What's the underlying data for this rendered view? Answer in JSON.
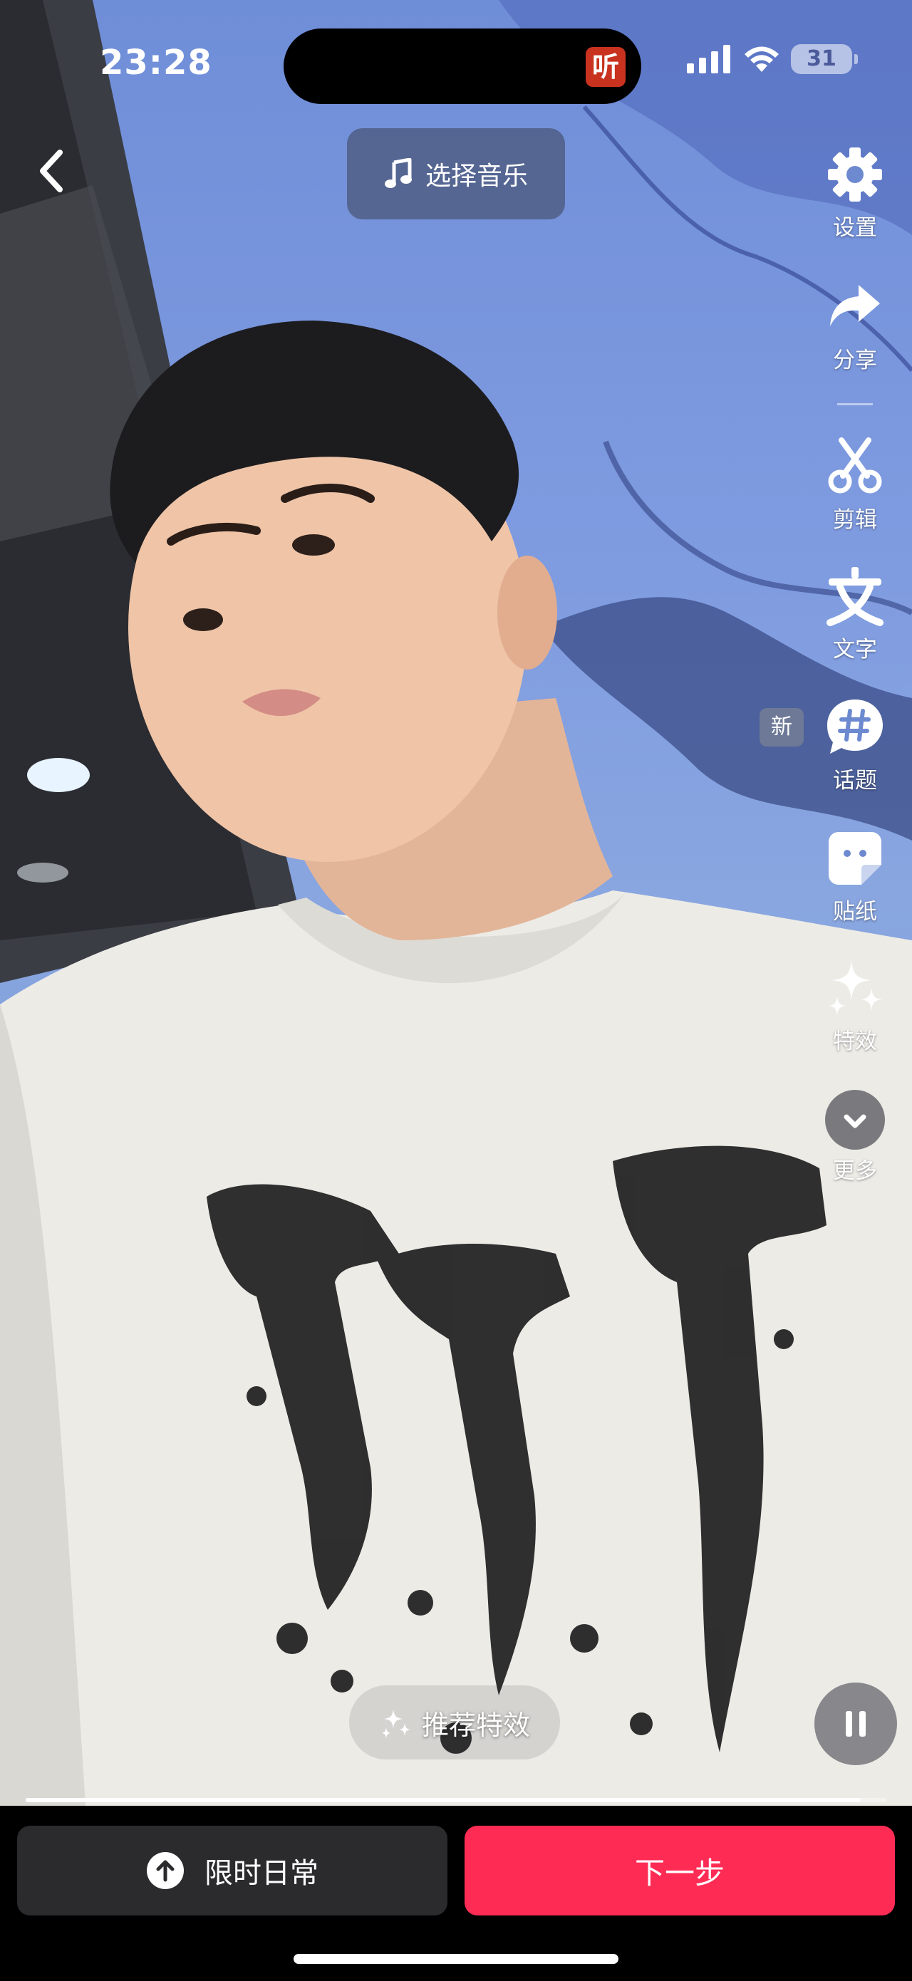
{
  "status_bar": {
    "time": "23:28",
    "island_app_glyph": "听",
    "battery_level": "31"
  },
  "top": {
    "back_icon": "chevron-left-icon",
    "music_label": "选择音乐",
    "music_icon": "music-note-icon"
  },
  "tools": {
    "settings": "设置",
    "share": "分享",
    "edit": "剪辑",
    "text": "文字",
    "topic": "话题",
    "topic_badge": "新",
    "sticker": "贴纸",
    "effects": "特效",
    "more": "更多"
  },
  "overlay": {
    "recommended_effects": "推荐特效",
    "progress_fraction": 0.97
  },
  "bottom": {
    "daily_label": "限时日常",
    "next_label": "下一步"
  },
  "colors": {
    "accent": "#fe2c55",
    "dark_button": "#2b2b2e"
  }
}
